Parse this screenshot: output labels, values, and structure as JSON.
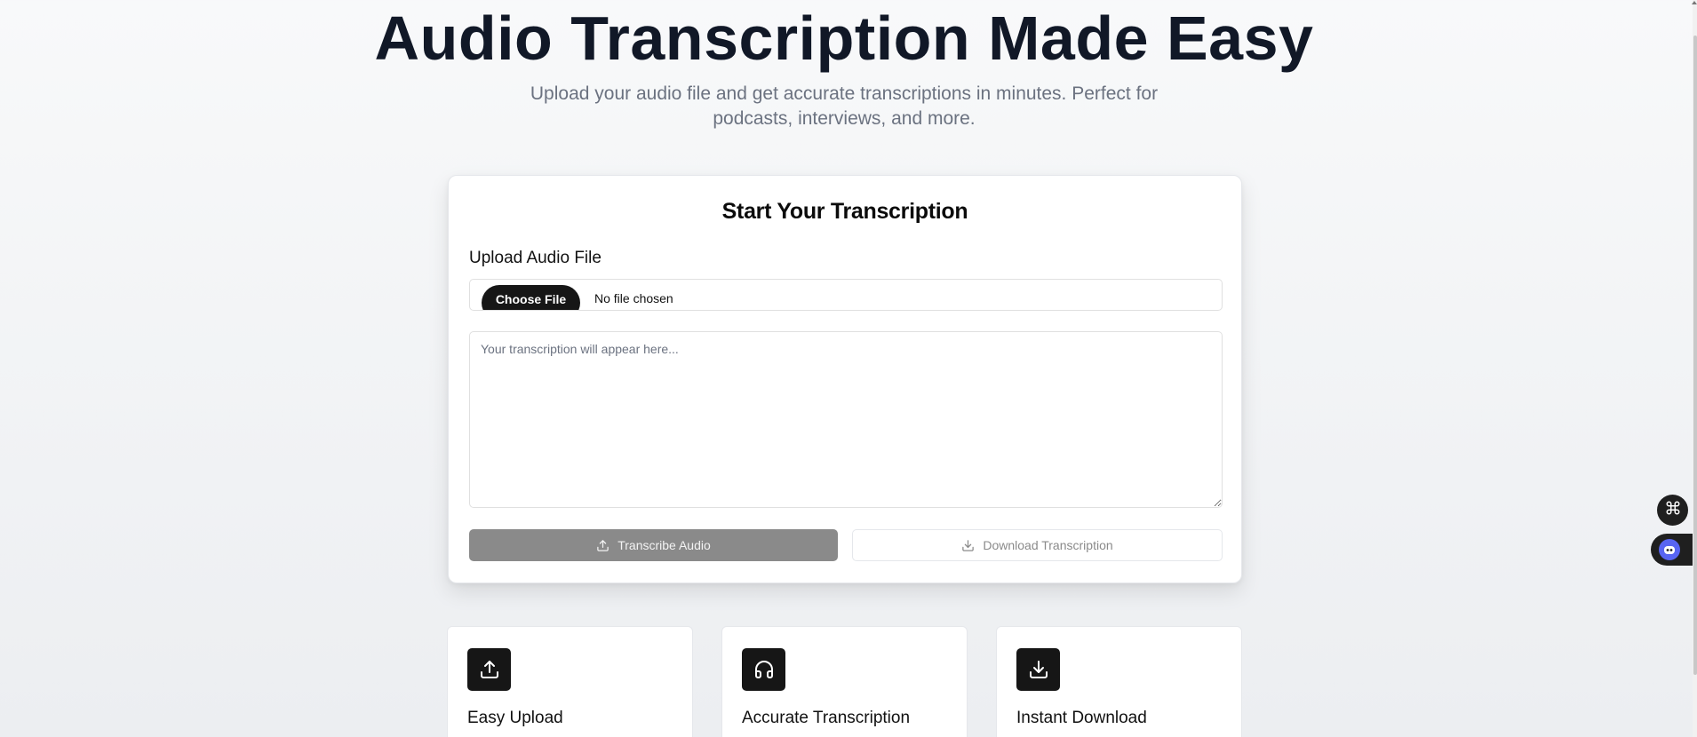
{
  "hero": {
    "title": "Audio Transcription Made Easy",
    "subtitle": "Upload your audio file and get accurate transcriptions in minutes. Perfect for podcasts, interviews, and more."
  },
  "transcription_card": {
    "title": "Start Your Transcription",
    "upload_label": "Upload Audio File",
    "choose_file_label": "Choose File",
    "file_status": "No file chosen",
    "textarea_placeholder": "Your transcription will appear here...",
    "transcribe_button": "Transcribe Audio",
    "download_button": "Download Transcription"
  },
  "features": [
    {
      "title": "Easy Upload",
      "icon": "upload-icon"
    },
    {
      "title": "Accurate Transcription",
      "icon": "headphones-icon"
    },
    {
      "title": "Instant Download",
      "icon": "download-icon"
    }
  ],
  "side_widgets": {
    "grid_icon": "command-grid-icon",
    "assistant_icon": "bot-face-icon"
  },
  "colors": {
    "primary_dark": "#161616",
    "disabled_button": "#8a8a8a",
    "muted_text": "#6b7280",
    "heading_text": "#111827",
    "assistant_accent": "#5865f2"
  }
}
